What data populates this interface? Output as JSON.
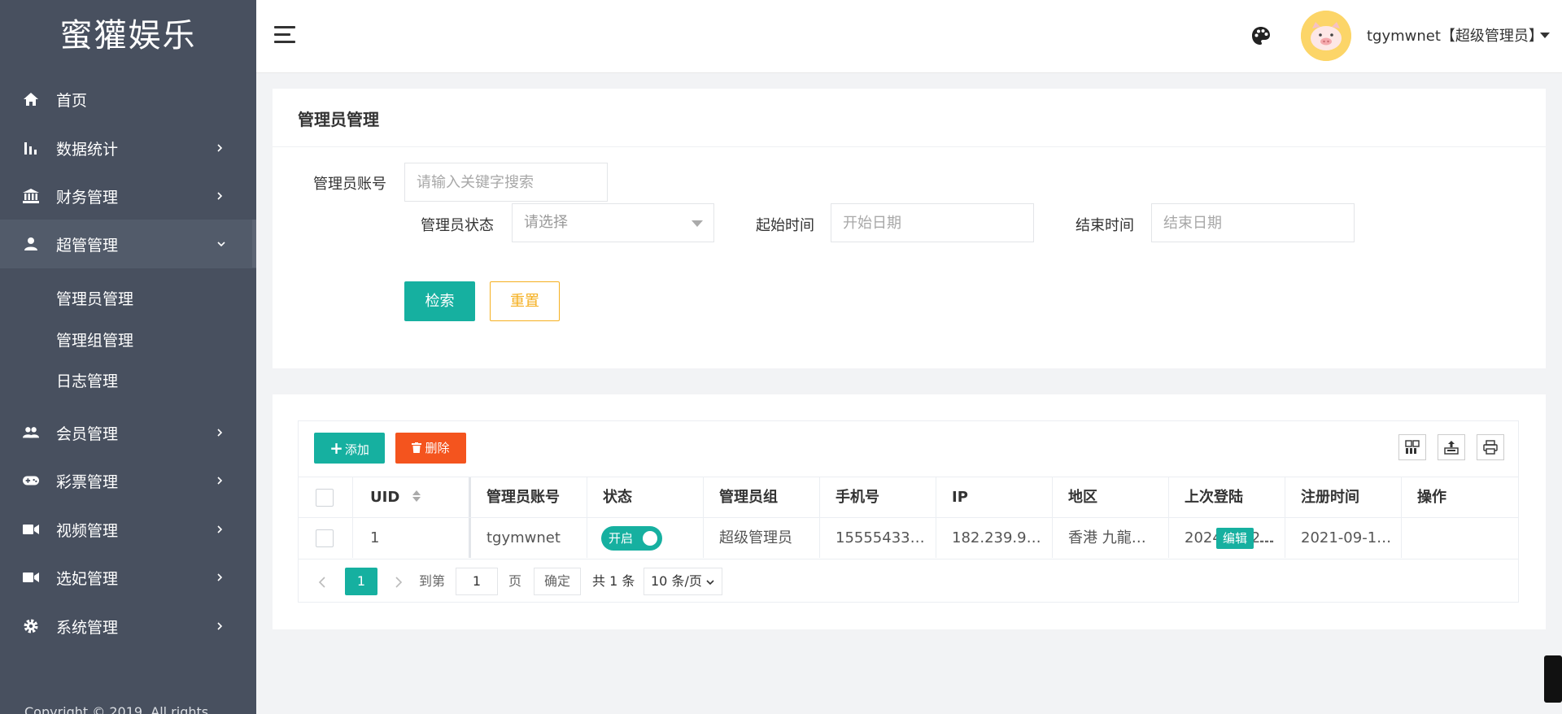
{
  "sidebar": {
    "logo": "蜜獾娱乐",
    "items": [
      {
        "label": "首页",
        "icon": "home-icon"
      },
      {
        "label": "数据统计",
        "icon": "bar-chart-icon"
      },
      {
        "label": "财务管理",
        "icon": "bank-icon"
      },
      {
        "label": "超管管理",
        "icon": "user-icon"
      },
      {
        "label": "会员管理",
        "icon": "users-icon"
      },
      {
        "label": "彩票管理",
        "icon": "gamepad-icon"
      },
      {
        "label": "视频管理",
        "icon": "video-camera-icon"
      },
      {
        "label": "选妃管理",
        "icon": "video-camera-icon"
      },
      {
        "label": "系统管理",
        "icon": "gear-icon"
      }
    ],
    "sub_items": [
      "管理员管理",
      "管理组管理",
      "日志管理"
    ],
    "copyright": "Copyright © 2019. All rights"
  },
  "header": {
    "user": "tgymwnet【超级管理员】"
  },
  "search": {
    "title": "管理员管理",
    "account_label": "管理员账号",
    "account_placeholder": "请输入关键字搜索",
    "status_label": "管理员状态",
    "status_placeholder": "请选择",
    "start_label": "起始时间",
    "start_placeholder": "开始日期",
    "end_label": "结束时间",
    "end_placeholder": "结束日期",
    "search_button": "检索",
    "reset_button": "重置"
  },
  "table": {
    "add_button": "添加",
    "delete_button": "删除",
    "columns": [
      "UID",
      "管理员账号",
      "状态",
      "管理员组",
      "手机号",
      "IP",
      "地区",
      "上次登陆",
      "注册时间",
      "操作"
    ],
    "rows": [
      {
        "uid": "1",
        "account": "tgymwnet",
        "status": "开启",
        "group": "超级管理员",
        "phone": "15555433…",
        "ip": "182.239.9…",
        "region": "香港 九龍…",
        "last_login": "2024-11-2…",
        "registered": "2021-09-1…",
        "edit": "编辑",
        "more": "…"
      }
    ]
  },
  "pagination": {
    "current_page": "1",
    "goto_label": "到第",
    "goto_value": "1",
    "page_unit": "页",
    "confirm": "确定",
    "total": "共 1 条",
    "page_size": "10 条/页"
  },
  "colors": {
    "sidebar": "#48505f",
    "primary": "#16b0a0",
    "danger": "#f4541e",
    "warning": "#f5b020"
  }
}
